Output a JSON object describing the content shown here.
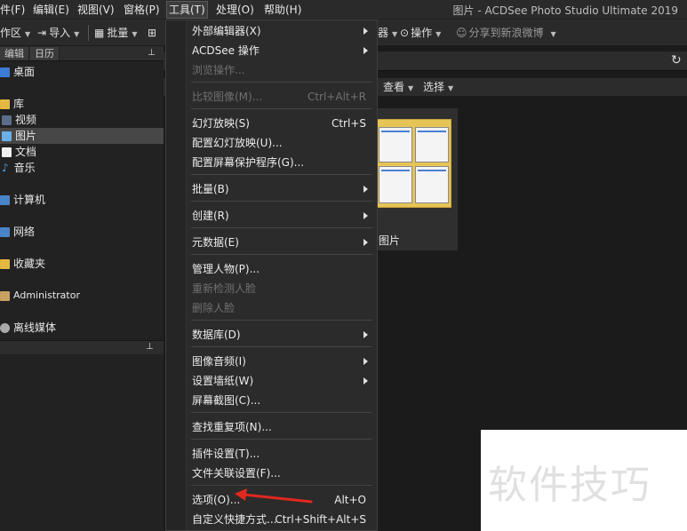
{
  "menubar": {
    "items": [
      "件(F)",
      "编辑(E)",
      "视图(V)",
      "窗格(P)",
      "工具(T)",
      "处理(O)",
      "帮助(H)"
    ],
    "title": "图片 - ACDSee Photo Studio Ultimate 2019"
  },
  "toolbar": {
    "workspace": "作区",
    "import": "导入",
    "batch": "批量",
    "right_partial": "器",
    "actions": "操作",
    "share": "分享到新浪微博"
  },
  "left_panel": {
    "tabs": [
      "编辑",
      "日历"
    ],
    "tree": [
      "桌面",
      "库",
      "视频",
      "图片",
      "文档",
      "音乐",
      "计算机",
      "网络",
      "收藏夹",
      "Administrator",
      "离线媒体"
    ]
  },
  "main": {
    "view_menu": "查看",
    "select_menu": "选择",
    "folder_label": "的图片"
  },
  "tools_menu": {
    "items": [
      {
        "label": "外部编辑器(X)",
        "shortcut": "",
        "submenu": true,
        "disabled": false
      },
      {
        "label": "ACDSee 操作",
        "shortcut": "",
        "submenu": true,
        "disabled": false
      },
      {
        "label": "浏览操作...",
        "shortcut": "",
        "submenu": false,
        "disabled": true
      },
      {
        "label": "比较图像(M)...",
        "shortcut": "Ctrl+Alt+R",
        "submenu": false,
        "disabled": true
      },
      {
        "label": "幻灯放映(S)",
        "shortcut": "Ctrl+S",
        "submenu": false,
        "disabled": false
      },
      {
        "label": "配置幻灯放映(U)...",
        "shortcut": "",
        "submenu": false,
        "disabled": false
      },
      {
        "label": "配置屏幕保护程序(G)...",
        "shortcut": "",
        "submenu": false,
        "disabled": false
      },
      {
        "label": "批量(B)",
        "shortcut": "",
        "submenu": true,
        "disabled": false
      },
      {
        "label": "创建(R)",
        "shortcut": "",
        "submenu": true,
        "disabled": false
      },
      {
        "label": "元数据(E)",
        "shortcut": "",
        "submenu": true,
        "disabled": false
      },
      {
        "label": "管理人物(P)...",
        "shortcut": "",
        "submenu": false,
        "disabled": false
      },
      {
        "label": "重新检测人脸",
        "shortcut": "",
        "submenu": false,
        "disabled": true
      },
      {
        "label": "删除人脸",
        "shortcut": "",
        "submenu": false,
        "disabled": true
      },
      {
        "label": "数据库(D)",
        "shortcut": "",
        "submenu": true,
        "disabled": false
      },
      {
        "label": "图像音频(I)",
        "shortcut": "",
        "submenu": true,
        "disabled": false
      },
      {
        "label": "设置墙纸(W)",
        "shortcut": "",
        "submenu": true,
        "disabled": false
      },
      {
        "label": "屏幕截图(C)...",
        "shortcut": "",
        "submenu": false,
        "disabled": false
      },
      {
        "label": "查找重复项(N)...",
        "shortcut": "",
        "submenu": false,
        "disabled": false
      },
      {
        "label": "插件设置(T)...",
        "shortcut": "",
        "submenu": false,
        "disabled": false
      },
      {
        "label": "文件关联设置(F)...",
        "shortcut": "",
        "submenu": false,
        "disabled": false
      },
      {
        "label": "选项(O)...",
        "shortcut": "Alt+O",
        "submenu": false,
        "disabled": false
      },
      {
        "label": "自定义快捷方式...",
        "shortcut": "Ctrl+Shift+Alt+S",
        "submenu": false,
        "disabled": false
      }
    ]
  },
  "watermark": {
    "text": "软件技巧"
  },
  "colors": {
    "accent_arrow": "#e0281f"
  }
}
